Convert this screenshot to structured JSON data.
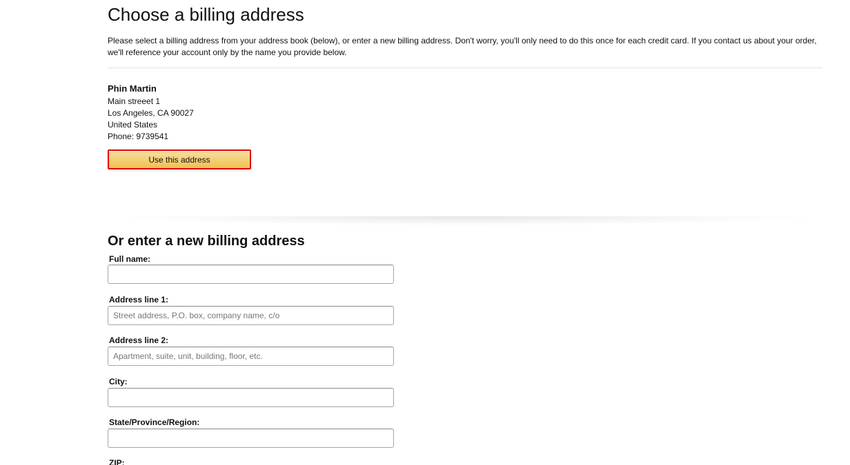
{
  "page": {
    "title": "Choose a billing address",
    "intro": "Please select a billing address from your address book (below), or enter a new billing address.  Don't worry, you'll only need to do this once for each credit card. If you contact us about your order, we'll reference your account only by the name you provide below."
  },
  "saved_address": {
    "name": "Phin Martin",
    "street": "Main streeet 1",
    "city_line": "Los Angeles, CA 90027",
    "country": "United States",
    "phone": "Phone: 9739541",
    "use_button_label": "Use this address"
  },
  "new_address": {
    "heading": "Or enter a new billing address",
    "fields": {
      "full_name": {
        "label": "Full name:",
        "value": "",
        "placeholder": ""
      },
      "address_line_1": {
        "label": "Address line 1:",
        "value": "",
        "placeholder": "Street address, P.O. box, company name, c/o"
      },
      "address_line_2": {
        "label": "Address line 2:",
        "value": "",
        "placeholder": "Apartment, suite, unit, building, floor, etc."
      },
      "city": {
        "label": "City:",
        "value": "",
        "placeholder": ""
      },
      "state": {
        "label": "State/Province/Region:",
        "value": "",
        "placeholder": ""
      },
      "zip": {
        "label": "ZIP:"
      }
    }
  },
  "colors": {
    "button_gradient_top": "#f7dfa5",
    "button_gradient_bottom": "#f0c14b",
    "highlight_border": "#e00000"
  }
}
